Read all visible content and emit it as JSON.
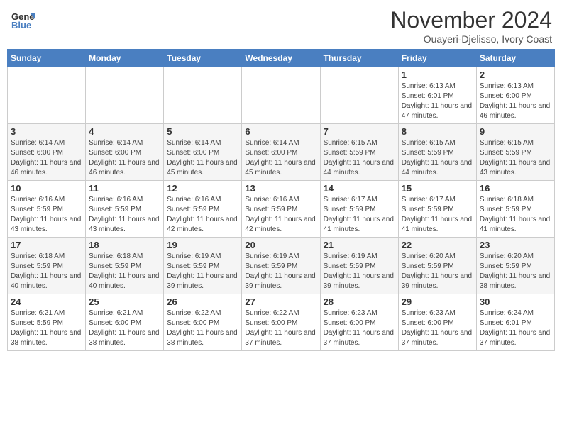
{
  "header": {
    "logo_line1": "General",
    "logo_line2": "Blue",
    "month_title": "November 2024",
    "location": "Ouayeri-Djelisso, Ivory Coast"
  },
  "weekdays": [
    "Sunday",
    "Monday",
    "Tuesday",
    "Wednesday",
    "Thursday",
    "Friday",
    "Saturday"
  ],
  "weeks": [
    [
      {
        "day": "",
        "info": ""
      },
      {
        "day": "",
        "info": ""
      },
      {
        "day": "",
        "info": ""
      },
      {
        "day": "",
        "info": ""
      },
      {
        "day": "",
        "info": ""
      },
      {
        "day": "1",
        "info": "Sunrise: 6:13 AM\nSunset: 6:01 PM\nDaylight: 11 hours and 47 minutes."
      },
      {
        "day": "2",
        "info": "Sunrise: 6:13 AM\nSunset: 6:00 PM\nDaylight: 11 hours and 46 minutes."
      }
    ],
    [
      {
        "day": "3",
        "info": "Sunrise: 6:14 AM\nSunset: 6:00 PM\nDaylight: 11 hours and 46 minutes."
      },
      {
        "day": "4",
        "info": "Sunrise: 6:14 AM\nSunset: 6:00 PM\nDaylight: 11 hours and 46 minutes."
      },
      {
        "day": "5",
        "info": "Sunrise: 6:14 AM\nSunset: 6:00 PM\nDaylight: 11 hours and 45 minutes."
      },
      {
        "day": "6",
        "info": "Sunrise: 6:14 AM\nSunset: 6:00 PM\nDaylight: 11 hours and 45 minutes."
      },
      {
        "day": "7",
        "info": "Sunrise: 6:15 AM\nSunset: 5:59 PM\nDaylight: 11 hours and 44 minutes."
      },
      {
        "day": "8",
        "info": "Sunrise: 6:15 AM\nSunset: 5:59 PM\nDaylight: 11 hours and 44 minutes."
      },
      {
        "day": "9",
        "info": "Sunrise: 6:15 AM\nSunset: 5:59 PM\nDaylight: 11 hours and 43 minutes."
      }
    ],
    [
      {
        "day": "10",
        "info": "Sunrise: 6:16 AM\nSunset: 5:59 PM\nDaylight: 11 hours and 43 minutes."
      },
      {
        "day": "11",
        "info": "Sunrise: 6:16 AM\nSunset: 5:59 PM\nDaylight: 11 hours and 43 minutes."
      },
      {
        "day": "12",
        "info": "Sunrise: 6:16 AM\nSunset: 5:59 PM\nDaylight: 11 hours and 42 minutes."
      },
      {
        "day": "13",
        "info": "Sunrise: 6:16 AM\nSunset: 5:59 PM\nDaylight: 11 hours and 42 minutes."
      },
      {
        "day": "14",
        "info": "Sunrise: 6:17 AM\nSunset: 5:59 PM\nDaylight: 11 hours and 41 minutes."
      },
      {
        "day": "15",
        "info": "Sunrise: 6:17 AM\nSunset: 5:59 PM\nDaylight: 11 hours and 41 minutes."
      },
      {
        "day": "16",
        "info": "Sunrise: 6:18 AM\nSunset: 5:59 PM\nDaylight: 11 hours and 41 minutes."
      }
    ],
    [
      {
        "day": "17",
        "info": "Sunrise: 6:18 AM\nSunset: 5:59 PM\nDaylight: 11 hours and 40 minutes."
      },
      {
        "day": "18",
        "info": "Sunrise: 6:18 AM\nSunset: 5:59 PM\nDaylight: 11 hours and 40 minutes."
      },
      {
        "day": "19",
        "info": "Sunrise: 6:19 AM\nSunset: 5:59 PM\nDaylight: 11 hours and 39 minutes."
      },
      {
        "day": "20",
        "info": "Sunrise: 6:19 AM\nSunset: 5:59 PM\nDaylight: 11 hours and 39 minutes."
      },
      {
        "day": "21",
        "info": "Sunrise: 6:19 AM\nSunset: 5:59 PM\nDaylight: 11 hours and 39 minutes."
      },
      {
        "day": "22",
        "info": "Sunrise: 6:20 AM\nSunset: 5:59 PM\nDaylight: 11 hours and 39 minutes."
      },
      {
        "day": "23",
        "info": "Sunrise: 6:20 AM\nSunset: 5:59 PM\nDaylight: 11 hours and 38 minutes."
      }
    ],
    [
      {
        "day": "24",
        "info": "Sunrise: 6:21 AM\nSunset: 5:59 PM\nDaylight: 11 hours and 38 minutes."
      },
      {
        "day": "25",
        "info": "Sunrise: 6:21 AM\nSunset: 6:00 PM\nDaylight: 11 hours and 38 minutes."
      },
      {
        "day": "26",
        "info": "Sunrise: 6:22 AM\nSunset: 6:00 PM\nDaylight: 11 hours and 38 minutes."
      },
      {
        "day": "27",
        "info": "Sunrise: 6:22 AM\nSunset: 6:00 PM\nDaylight: 11 hours and 37 minutes."
      },
      {
        "day": "28",
        "info": "Sunrise: 6:23 AM\nSunset: 6:00 PM\nDaylight: 11 hours and 37 minutes."
      },
      {
        "day": "29",
        "info": "Sunrise: 6:23 AM\nSunset: 6:00 PM\nDaylight: 11 hours and 37 minutes."
      },
      {
        "day": "30",
        "info": "Sunrise: 6:24 AM\nSunset: 6:01 PM\nDaylight: 11 hours and 37 minutes."
      }
    ]
  ]
}
